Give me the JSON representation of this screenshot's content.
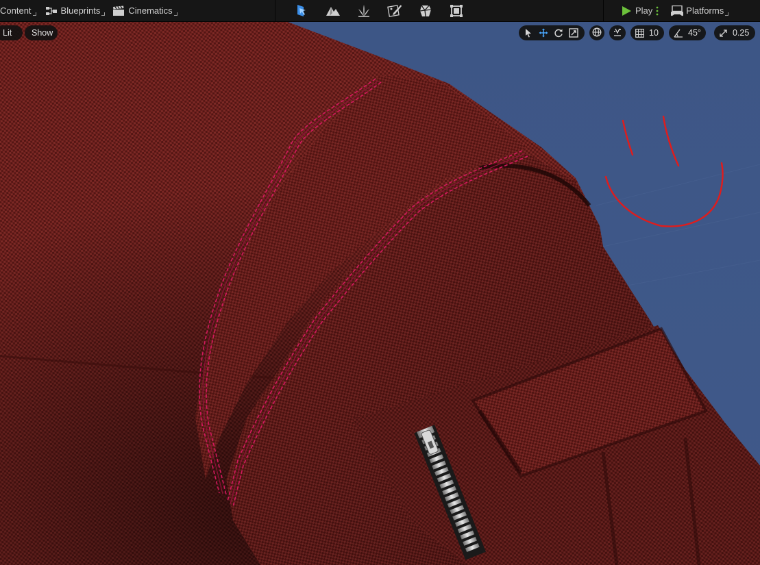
{
  "toolbar": {
    "content_label": "Content",
    "blueprints_label": "Blueprints",
    "cinematics_label": "Cinematics",
    "mode_icons": [
      "select-mode-icon",
      "landscape-mode-icon",
      "foliage-mode-icon",
      "mesh-paint-mode-icon",
      "fracture-mode-icon",
      "modeling-mode-icon"
    ],
    "play_label": "Play",
    "platforms_label": "Platforms"
  },
  "viewport": {
    "view_mode_label": "Lit",
    "show_label": "Show",
    "grid_snap_value": "10",
    "rotation_snap_value": "45°",
    "scale_snap_value": "0.25",
    "transform_tools": [
      "select-arrow-icon",
      "translate-icon",
      "rotate-icon",
      "scale-icon"
    ]
  },
  "colors": {
    "toolbar_bg": "#161616",
    "sky": "#3c5383",
    "fabric": "#6a1d1b",
    "stitching": "#d4185f",
    "play_green": "#6cc13b",
    "accent_blue": "#4aa8ff",
    "annotation_red": "#e01c1c"
  }
}
